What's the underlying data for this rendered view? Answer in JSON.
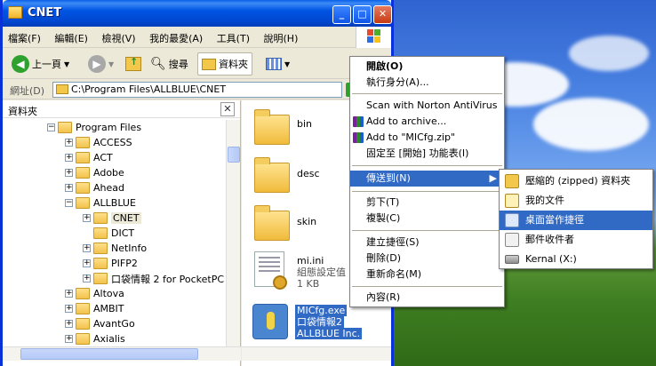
{
  "window": {
    "title": "CNET",
    "menu": [
      "檔案(F)",
      "編輯(E)",
      "檢視(V)",
      "我的最愛(A)",
      "工具(T)",
      "說明(H)"
    ],
    "toolbar": {
      "back": "上一頁",
      "search": "搜尋",
      "folders": "資料夾"
    },
    "address": {
      "label": "網址(D)",
      "value": "C:\\Program Files\\ALLBLUE\\CNET"
    }
  },
  "folders_pane": {
    "title": "資料夾",
    "tree": [
      {
        "label": "Program Files",
        "toggle": "−"
      },
      {
        "label": "ACCESS",
        "toggle": "+"
      },
      {
        "label": "ACT",
        "toggle": "+"
      },
      {
        "label": "Adobe",
        "toggle": "+"
      },
      {
        "label": "Ahead",
        "toggle": "+"
      },
      {
        "label": "ALLBLUE",
        "toggle": "−"
      },
      {
        "label": "CNET",
        "toggle": "+"
      },
      {
        "label": "DICT",
        "toggle": ""
      },
      {
        "label": "NetInfo",
        "toggle": "+"
      },
      {
        "label": "PIFP2",
        "toggle": "+"
      },
      {
        "label": "口袋情報 2 for PocketPC",
        "toggle": "+"
      },
      {
        "label": "Altova",
        "toggle": "+"
      },
      {
        "label": "AMBIT",
        "toggle": "+"
      },
      {
        "label": "AvantGo",
        "toggle": "+"
      },
      {
        "label": "Axialis",
        "toggle": "+"
      }
    ]
  },
  "files": [
    {
      "name": "bin"
    },
    {
      "name": "desc"
    },
    {
      "name": "skin"
    },
    {
      "name": "mi.ini",
      "line2": "組態設定值",
      "line3": "1 KB"
    },
    {
      "name": "MICfg.exe",
      "line2": "口袋情報2",
      "line3": "ALLBLUE Inc."
    }
  ],
  "context_menu": {
    "items": [
      "開啟(O)",
      "執行身分(A)...",
      "Scan with Norton AntiVirus",
      "Add to archive...",
      "Add to \"MICfg.zip\"",
      "固定至 [開始] 功能表(I)",
      "傳送到(N)",
      "剪下(T)",
      "複製(C)",
      "建立捷徑(S)",
      "刪除(D)",
      "重新命名(M)",
      "內容(R)"
    ]
  },
  "send_to_menu": {
    "items": [
      "壓縮的 (zipped) 資料夾",
      "我的文件",
      "桌面當作捷徑",
      "郵件收件者",
      "Kernal (X:)"
    ]
  },
  "colors": {
    "selection": "#316ac5",
    "titlebar": "#0054e3"
  }
}
